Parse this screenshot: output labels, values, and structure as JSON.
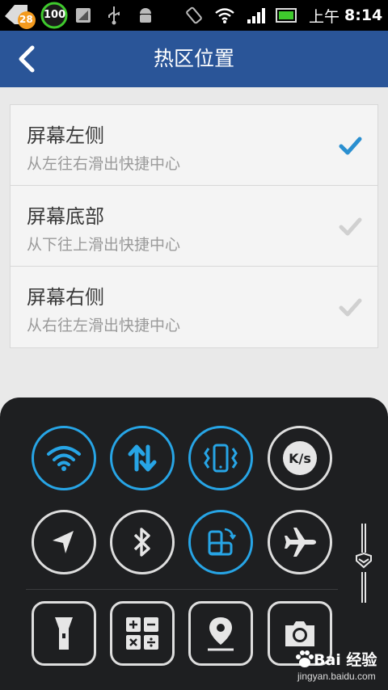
{
  "status_bar": {
    "notification_count": "28",
    "battery_level": "100",
    "time_prefix": "上午",
    "time": "8:14",
    "icons": [
      "notification-icon",
      "battery-circle-icon",
      "screenshot-icon",
      "usb-icon",
      "android-debug-icon",
      "rotate-icon",
      "wifi-icon",
      "signal-icon",
      "battery-icon"
    ]
  },
  "header": {
    "title": "热区位置",
    "back_icon": "back-chevron-icon"
  },
  "options": [
    {
      "title": "屏幕左侧",
      "subtitle": "从左往右滑出快捷中心",
      "checked": true
    },
    {
      "title": "屏幕底部",
      "subtitle": "从下往上滑出快捷中心",
      "checked": false
    },
    {
      "title": "屏幕右侧",
      "subtitle": "从右往左滑出快捷中心",
      "checked": false
    }
  ],
  "quick_panel": {
    "row1": [
      {
        "name": "wifi-toggle",
        "icon": "wifi-icon",
        "on": true
      },
      {
        "name": "data-toggle",
        "icon": "data-arrows-icon",
        "on": true
      },
      {
        "name": "vibrate-toggle",
        "icon": "vibrate-icon",
        "on": true
      },
      {
        "name": "speed-toggle",
        "icon": "speed-icon",
        "label": "K/s",
        "on": false
      }
    ],
    "row2": [
      {
        "name": "gps-toggle",
        "icon": "location-arrow-icon",
        "on": false
      },
      {
        "name": "bluetooth-toggle",
        "icon": "bluetooth-icon",
        "on": false
      },
      {
        "name": "rotation-toggle",
        "icon": "rotate-screen-icon",
        "on": true
      },
      {
        "name": "airplane-toggle",
        "icon": "airplane-icon",
        "on": false
      }
    ],
    "row3": [
      {
        "name": "flashlight-button",
        "icon": "flashlight-icon"
      },
      {
        "name": "calculator-button",
        "icon": "calculator-icon"
      },
      {
        "name": "map-button",
        "icon": "map-pin-icon"
      },
      {
        "name": "camera-button",
        "icon": "camera-icon"
      }
    ]
  },
  "watermark": {
    "text": "Bai 经验",
    "url": "jingyan.baidu.com"
  },
  "colors": {
    "header_bg": "#2a5598",
    "accent": "#27a5e6",
    "check_on": "#2a8fd0",
    "check_off": "#d0d0d0",
    "panel_bg": "#1e1f21"
  }
}
